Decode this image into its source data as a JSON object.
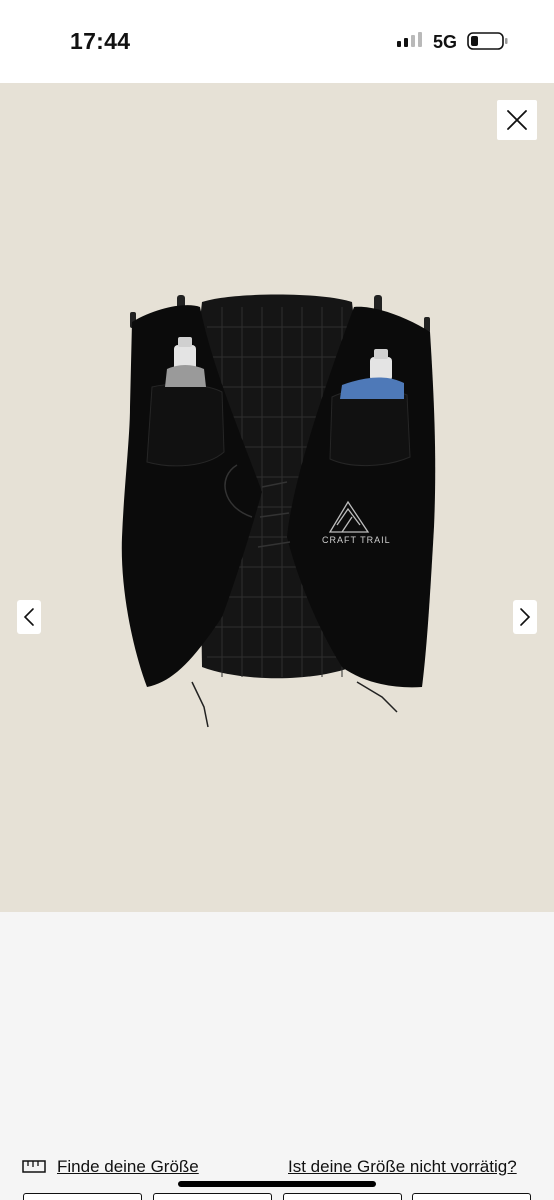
{
  "status_bar": {
    "time": "17:44",
    "network": "5G",
    "icons": [
      "signal-icon",
      "battery-icon"
    ]
  },
  "gallery": {
    "background_color": "#e6e1d6",
    "product_logo_text": "CRAFT TRAIL",
    "icons": [
      "close-icon",
      "chevron-left-icon",
      "chevron-right-icon"
    ]
  },
  "size_links": {
    "find_size": "Finde deine Größe",
    "size_unavailable": "Ist deine Größe nicht vorrätig?"
  },
  "colors": {
    "accent": "#111111",
    "lower_background": "#f5f5f5"
  }
}
